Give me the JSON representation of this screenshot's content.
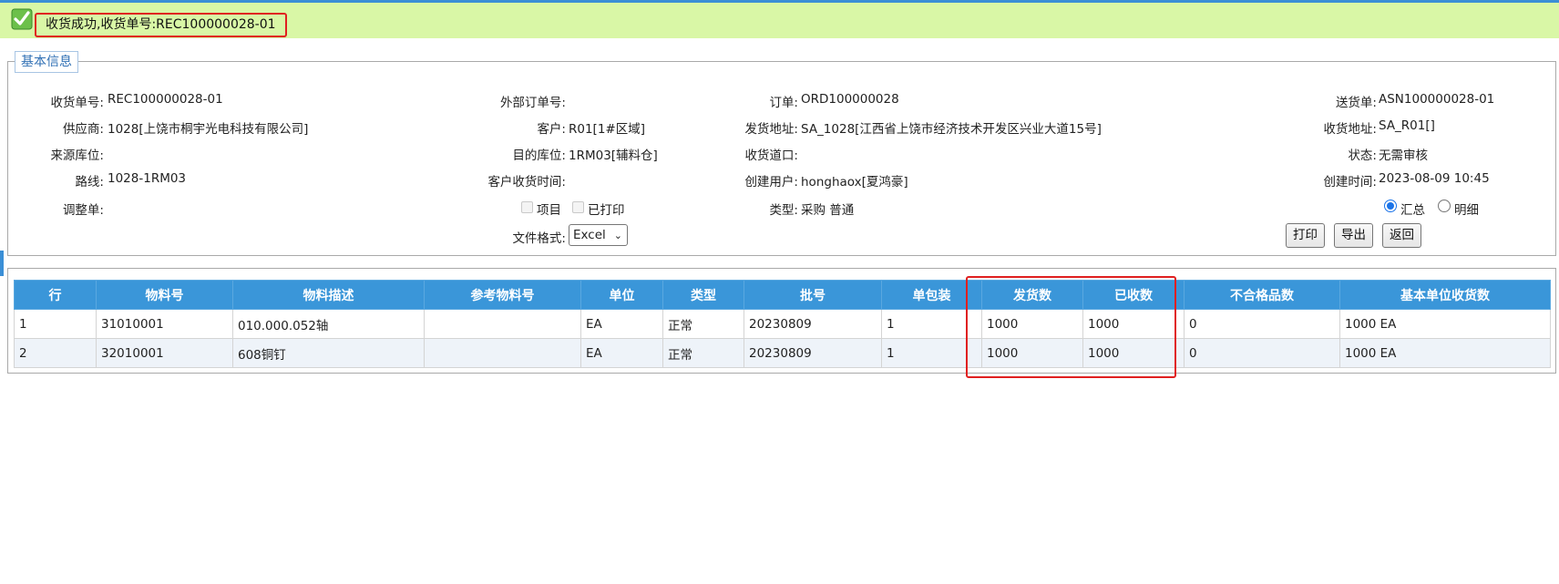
{
  "notice": {
    "message": "收货成功,收货单号:REC100000028-01"
  },
  "section": {
    "title": "基本信息"
  },
  "info": {
    "receipt_no": {
      "label": "收货单号:",
      "value": "REC100000028-01"
    },
    "supplier": {
      "label": "供应商:",
      "value": "1028[上饶市桐宇光电科技有限公司]"
    },
    "source_location": {
      "label": "来源库位:",
      "value": ""
    },
    "route": {
      "label": "路线:",
      "value": "1028-1RM03"
    },
    "adjust_order": {
      "label": "调整单:",
      "value": ""
    },
    "external_order": {
      "label": "外部订单号:",
      "value": ""
    },
    "customer": {
      "label": "客户:",
      "value": "R01[1#区域]"
    },
    "dest_location": {
      "label": "目的库位:",
      "value": "1RM03[辅料仓]"
    },
    "customer_receipt_time": {
      "label": "客户收货时间:",
      "value": ""
    },
    "order": {
      "label": "订单:",
      "value": "ORD100000028"
    },
    "ship_address": {
      "label": "发货地址:",
      "value": "SA_1028[江西省上饶市经济技术开发区兴业大道15号]"
    },
    "dock": {
      "label": "收货道口:",
      "value": ""
    },
    "created_by": {
      "label": "创建用户:",
      "value": "honghaox[夏鸿豪]"
    },
    "type": {
      "label": "类型:",
      "value": "采购 普通"
    },
    "asn": {
      "label": "送货单:",
      "value": "ASN100000028-01"
    },
    "receive_address": {
      "label": "收货地址:",
      "value": "SA_R01[]"
    },
    "status": {
      "label": "状态:",
      "value": "无需审核"
    },
    "created_time": {
      "label": "创建时间:",
      "value": "2023-08-09 10:45"
    }
  },
  "options": {
    "item_checkbox_label": "项目",
    "printed_checkbox_label": "已打印",
    "file_format_label": "文件格式:",
    "file_format_value": "Excel",
    "summary_label": "汇总",
    "detail_label": "明细",
    "view_mode": "汇总"
  },
  "actions": {
    "print": "打印",
    "export": "导出",
    "back": "返回"
  },
  "table": {
    "headers": [
      "行",
      "物料号",
      "物料描述",
      "参考物料号",
      "单位",
      "类型",
      "批号",
      "单包装",
      "发货数",
      "已收数",
      "不合格品数",
      "基本单位收货数"
    ],
    "rows": [
      [
        "1",
        "31010001",
        "010.000.052轴",
        "",
        "EA",
        "正常",
        "20230809",
        "1",
        "1000",
        "1000",
        "0",
        "1000 EA"
      ],
      [
        "2",
        "32010001",
        "608铜钉",
        "",
        "EA",
        "正常",
        "20230809",
        "1",
        "1000",
        "1000",
        "0",
        "1000 EA"
      ]
    ]
  },
  "colors": {
    "header": "#3a96d9",
    "success_bg": "#d9f7a6",
    "highlight": "#e02020"
  },
  "icons": {
    "success": "check-icon"
  }
}
